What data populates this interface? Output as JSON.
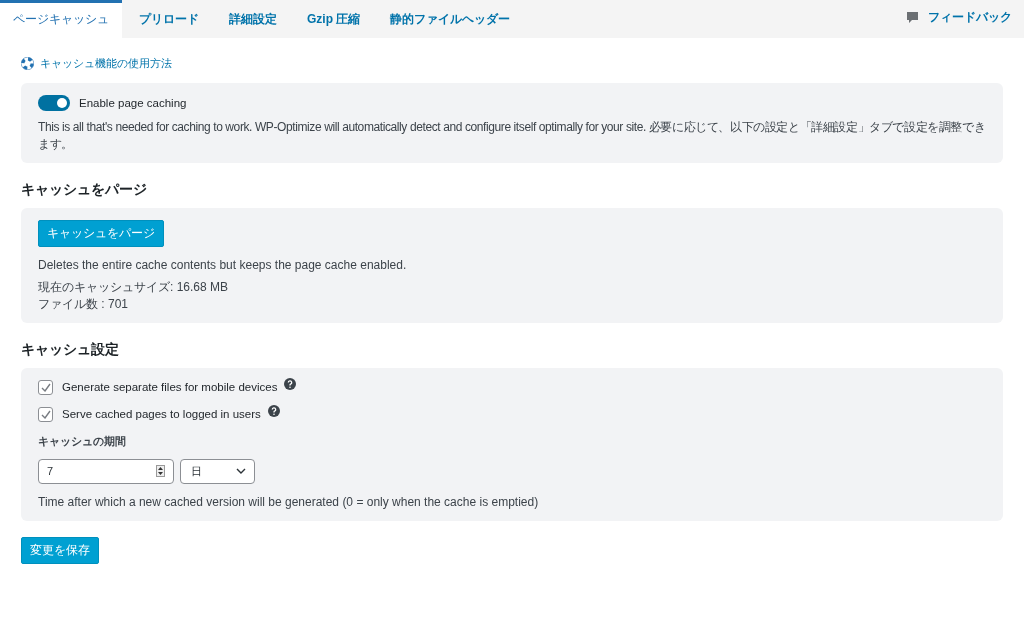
{
  "tabs": [
    {
      "label": "ページキャッシュ",
      "selected": true
    },
    {
      "label": "プリロード",
      "selected": false
    },
    {
      "label": "詳細設定",
      "selected": false
    },
    {
      "label": "Gzip 圧縮",
      "selected": false
    },
    {
      "label": "静的ファイルヘッダー",
      "selected": false
    }
  ],
  "feedback": "フィードバック",
  "help_link": "キャッシュ機能の使用方法",
  "enable": {
    "label": "Enable page caching",
    "on": true,
    "description": "This is all that's needed for caching to work. WP-Optimize will automatically detect and configure itself optimally for your site. 必要に応じて、以下の設定と「詳細設定」タブで設定を調整できます。"
  },
  "purge": {
    "heading": "キャッシュをパージ",
    "button": "キャッシュをパージ",
    "description": "Deletes the entire cache contents but keeps the page cache enabled.",
    "size": "現在のキャッシュサイズ: 16.68 MB",
    "files": "ファイル数 : 701"
  },
  "settings": {
    "heading": "キャッシュ設定",
    "options": [
      {
        "label": "Generate separate files for mobile devices",
        "checked": true
      },
      {
        "label": "Serve cached pages to logged in users",
        "checked": true
      }
    ],
    "expiry_label": "キャッシュの期間",
    "expiry_value": "7",
    "expiry_unit": "日",
    "hint": "Time after which a new cached version will be generated (0 = only when the cache is emptied)"
  },
  "save_button": "変更を保存"
}
